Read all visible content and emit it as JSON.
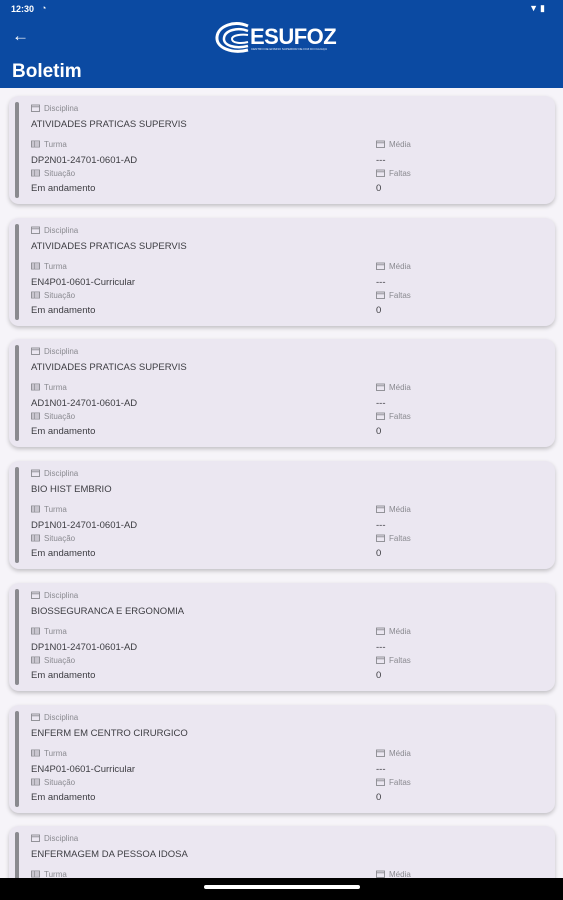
{
  "status_bar": {
    "time": "12:30"
  },
  "app_bar": {
    "logo_text": "ESUFOZ",
    "logo_subtitle": "CENTRO DE ENSINO SUPERIOR DE FOZ DO IGUAÇU",
    "title": "Boletim"
  },
  "labels": {
    "disciplina": "Disciplina",
    "turma": "Turma",
    "situacao": "Situação",
    "media": "Média",
    "faltas": "Faltas"
  },
  "cards": [
    {
      "disciplina": "ATIVIDADES PRATICAS SUPERVIS",
      "turma": "DP2N01-24701-0601-AD",
      "situacao": "Em andamento",
      "media": "---",
      "faltas": "0"
    },
    {
      "disciplina": "ATIVIDADES PRATICAS SUPERVIS",
      "turma": "EN4P01-0601-Curricular",
      "situacao": "Em andamento",
      "media": "---",
      "faltas": "0"
    },
    {
      "disciplina": "ATIVIDADES PRATICAS SUPERVIS",
      "turma": "AD1N01-24701-0601-AD",
      "situacao": "Em andamento",
      "media": "---",
      "faltas": "0"
    },
    {
      "disciplina": "BIO HIST EMBRIO",
      "turma": "DP1N01-24701-0601-AD",
      "situacao": "Em andamento",
      "media": "---",
      "faltas": "0"
    },
    {
      "disciplina": "BIOSSEGURANCA E ERGONOMIA",
      "turma": "DP1N01-24701-0601-AD",
      "situacao": "Em andamento",
      "media": "---",
      "faltas": "0"
    },
    {
      "disciplina": "ENFERM EM CENTRO CIRURGICO",
      "turma": "EN4P01-0601-Curricular",
      "situacao": "Em andamento",
      "media": "---",
      "faltas": "0"
    },
    {
      "disciplina": "ENFERMAGEM DA PESSOA IDOSA",
      "turma": "",
      "situacao": "",
      "media": "",
      "faltas": ""
    }
  ]
}
